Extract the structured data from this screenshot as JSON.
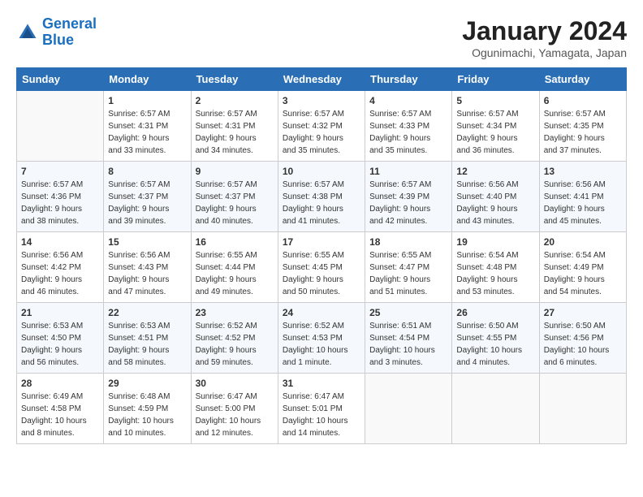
{
  "header": {
    "logo_line1": "General",
    "logo_line2": "Blue",
    "month_title": "January 2024",
    "subtitle": "Ogunimachi, Yamagata, Japan"
  },
  "weekdays": [
    "Sunday",
    "Monday",
    "Tuesday",
    "Wednesday",
    "Thursday",
    "Friday",
    "Saturday"
  ],
  "weeks": [
    [
      {
        "day": "",
        "info": ""
      },
      {
        "day": "1",
        "info": "Sunrise: 6:57 AM\nSunset: 4:31 PM\nDaylight: 9 hours\nand 33 minutes."
      },
      {
        "day": "2",
        "info": "Sunrise: 6:57 AM\nSunset: 4:31 PM\nDaylight: 9 hours\nand 34 minutes."
      },
      {
        "day": "3",
        "info": "Sunrise: 6:57 AM\nSunset: 4:32 PM\nDaylight: 9 hours\nand 35 minutes."
      },
      {
        "day": "4",
        "info": "Sunrise: 6:57 AM\nSunset: 4:33 PM\nDaylight: 9 hours\nand 35 minutes."
      },
      {
        "day": "5",
        "info": "Sunrise: 6:57 AM\nSunset: 4:34 PM\nDaylight: 9 hours\nand 36 minutes."
      },
      {
        "day": "6",
        "info": "Sunrise: 6:57 AM\nSunset: 4:35 PM\nDaylight: 9 hours\nand 37 minutes."
      }
    ],
    [
      {
        "day": "7",
        "info": "Sunrise: 6:57 AM\nSunset: 4:36 PM\nDaylight: 9 hours\nand 38 minutes."
      },
      {
        "day": "8",
        "info": "Sunrise: 6:57 AM\nSunset: 4:37 PM\nDaylight: 9 hours\nand 39 minutes."
      },
      {
        "day": "9",
        "info": "Sunrise: 6:57 AM\nSunset: 4:37 PM\nDaylight: 9 hours\nand 40 minutes."
      },
      {
        "day": "10",
        "info": "Sunrise: 6:57 AM\nSunset: 4:38 PM\nDaylight: 9 hours\nand 41 minutes."
      },
      {
        "day": "11",
        "info": "Sunrise: 6:57 AM\nSunset: 4:39 PM\nDaylight: 9 hours\nand 42 minutes."
      },
      {
        "day": "12",
        "info": "Sunrise: 6:56 AM\nSunset: 4:40 PM\nDaylight: 9 hours\nand 43 minutes."
      },
      {
        "day": "13",
        "info": "Sunrise: 6:56 AM\nSunset: 4:41 PM\nDaylight: 9 hours\nand 45 minutes."
      }
    ],
    [
      {
        "day": "14",
        "info": "Sunrise: 6:56 AM\nSunset: 4:42 PM\nDaylight: 9 hours\nand 46 minutes."
      },
      {
        "day": "15",
        "info": "Sunrise: 6:56 AM\nSunset: 4:43 PM\nDaylight: 9 hours\nand 47 minutes."
      },
      {
        "day": "16",
        "info": "Sunrise: 6:55 AM\nSunset: 4:44 PM\nDaylight: 9 hours\nand 49 minutes."
      },
      {
        "day": "17",
        "info": "Sunrise: 6:55 AM\nSunset: 4:45 PM\nDaylight: 9 hours\nand 50 minutes."
      },
      {
        "day": "18",
        "info": "Sunrise: 6:55 AM\nSunset: 4:47 PM\nDaylight: 9 hours\nand 51 minutes."
      },
      {
        "day": "19",
        "info": "Sunrise: 6:54 AM\nSunset: 4:48 PM\nDaylight: 9 hours\nand 53 minutes."
      },
      {
        "day": "20",
        "info": "Sunrise: 6:54 AM\nSunset: 4:49 PM\nDaylight: 9 hours\nand 54 minutes."
      }
    ],
    [
      {
        "day": "21",
        "info": "Sunrise: 6:53 AM\nSunset: 4:50 PM\nDaylight: 9 hours\nand 56 minutes."
      },
      {
        "day": "22",
        "info": "Sunrise: 6:53 AM\nSunset: 4:51 PM\nDaylight: 9 hours\nand 58 minutes."
      },
      {
        "day": "23",
        "info": "Sunrise: 6:52 AM\nSunset: 4:52 PM\nDaylight: 9 hours\nand 59 minutes."
      },
      {
        "day": "24",
        "info": "Sunrise: 6:52 AM\nSunset: 4:53 PM\nDaylight: 10 hours\nand 1 minute."
      },
      {
        "day": "25",
        "info": "Sunrise: 6:51 AM\nSunset: 4:54 PM\nDaylight: 10 hours\nand 3 minutes."
      },
      {
        "day": "26",
        "info": "Sunrise: 6:50 AM\nSunset: 4:55 PM\nDaylight: 10 hours\nand 4 minutes."
      },
      {
        "day": "27",
        "info": "Sunrise: 6:50 AM\nSunset: 4:56 PM\nDaylight: 10 hours\nand 6 minutes."
      }
    ],
    [
      {
        "day": "28",
        "info": "Sunrise: 6:49 AM\nSunset: 4:58 PM\nDaylight: 10 hours\nand 8 minutes."
      },
      {
        "day": "29",
        "info": "Sunrise: 6:48 AM\nSunset: 4:59 PM\nDaylight: 10 hours\nand 10 minutes."
      },
      {
        "day": "30",
        "info": "Sunrise: 6:47 AM\nSunset: 5:00 PM\nDaylight: 10 hours\nand 12 minutes."
      },
      {
        "day": "31",
        "info": "Sunrise: 6:47 AM\nSunset: 5:01 PM\nDaylight: 10 hours\nand 14 minutes."
      },
      {
        "day": "",
        "info": ""
      },
      {
        "day": "",
        "info": ""
      },
      {
        "day": "",
        "info": ""
      }
    ]
  ]
}
